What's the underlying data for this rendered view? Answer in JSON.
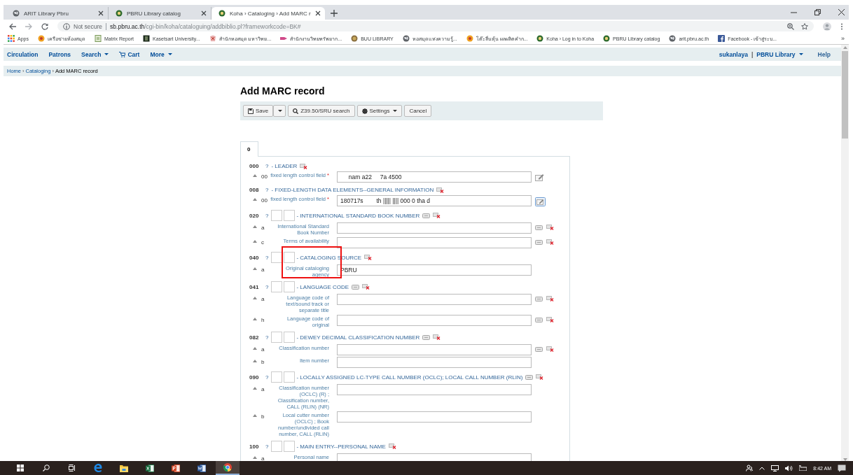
{
  "browser": {
    "tabs": [
      {
        "title": "ARIT Library Pbru",
        "selected": false
      },
      {
        "title": "PBRU Library catalog",
        "selected": false
      },
      {
        "title": "Koha › Cataloging › Add MARC r",
        "selected": true
      }
    ],
    "address": {
      "security": "Not secure",
      "host": "sb.pbru.ac.th",
      "path": "/cgi-bin/koha/cataloguing/addbiblio.pl?frameworkcode=BK#"
    },
    "bookmarks": [
      {
        "title": "Apps"
      },
      {
        "title": "เครือข่ายห้องสมุด"
      },
      {
        "title": "Matrix Report"
      },
      {
        "title": "Kasetsart University..."
      },
      {
        "title": "สำนักหอสมุด มหาวิทย..."
      },
      {
        "title": "สำนักงานวิทยทรัพยาก..."
      },
      {
        "title": "BUU LIBRARY"
      },
      {
        "title": "หอสมุดแห่งความรู้..."
      },
      {
        "title": "โต๊ะลื่นหุ้น ผลผลิตคำก..."
      },
      {
        "title": "Koha › Log in to Koha"
      },
      {
        "title": "PBRU Library catalog"
      },
      {
        "title": "arit.pbru.ac.th"
      },
      {
        "title": "Facebook - เข้าสู่ระบ..."
      }
    ],
    "more": "»"
  },
  "nav": {
    "left": [
      {
        "label": "Circulation",
        "kind": "link"
      },
      {
        "label": "Patrons",
        "kind": "link"
      },
      {
        "label": "Search",
        "kind": "menu"
      },
      {
        "label": "Cart",
        "kind": "cart"
      },
      {
        "label": "More",
        "kind": "menu"
      }
    ],
    "user": "sukanlaya",
    "separator": "|",
    "library": "PBRU Library",
    "help": "Help"
  },
  "breadcrumb": [
    {
      "label": "Home",
      "link": true
    },
    {
      "separator": "›",
      "label": "Cataloging",
      "link": true
    },
    {
      "separator": "›",
      "label": "Add MARC record",
      "link": false
    }
  ],
  "heading": "Add MARC record",
  "toolbar": [
    {
      "kind": "save",
      "label": "Save"
    },
    {
      "kind": "split"
    },
    {
      "kind": "search",
      "label": "Z39.50/SRU search"
    },
    {
      "kind": "settings",
      "label": "Settings"
    },
    {
      "kind": "plain",
      "label": "Cancel"
    }
  ],
  "tabs": [
    {
      "label": "0",
      "selected": true
    }
  ],
  "fields": [
    {
      "tag": "000",
      "help": "?",
      "indicators": false,
      "title": "- LEADER",
      "repeatable": false,
      "removable": true,
      "subfields": [
        {
          "code": "00",
          "label": "fixed length control field",
          "marker": "*",
          "value": "     nam a22     7a 4500",
          "repeatable": false,
          "removable": false,
          "plugin": true,
          "focused": false
        }
      ]
    },
    {
      "tag": "008",
      "help": "?",
      "indicators": false,
      "title": "- FIXED-LENGTH DATA ELEMENTS--GENERAL INFORMATION",
      "repeatable": false,
      "removable": true,
      "subfields": [
        {
          "code": "00",
          "label": "fixed length control field",
          "marker": "*",
          "value": "180717s        th ||||| |||| 000 0 tha d",
          "repeatable": false,
          "removable": false,
          "plugin": true,
          "focused": true
        }
      ]
    },
    {
      "tag": "020",
      "help": "?",
      "indicators": true,
      "title": "- INTERNATIONAL STANDARD BOOK NUMBER",
      "repeatable": true,
      "removable": true,
      "subfields": [
        {
          "code": "a",
          "label": "International Standard Book Number",
          "repeatable": true,
          "removable": true,
          "plugin": false
        },
        {
          "code": "c",
          "label": "Terms of availability",
          "repeatable": true,
          "removable": true,
          "plugin": false
        }
      ]
    },
    {
      "tag": "040",
      "help": "?",
      "indicators": true,
      "title": "- CATALOGING SOURCE",
      "repeatable": false,
      "removable": true,
      "subfields": [
        {
          "code": "a",
          "label": "Original cataloging agency",
          "value": "PBRU",
          "repeatable": false,
          "removable": false,
          "plugin": false
        }
      ]
    },
    {
      "tag": "041",
      "help": "?",
      "indicators": true,
      "title": "- LANGUAGE CODE",
      "repeatable": true,
      "removable": true,
      "subfields": [
        {
          "code": "a",
          "label": "Language code of text/sound track or separate title",
          "repeatable": true,
          "removable": true,
          "plugin": false
        },
        {
          "code": "h",
          "label": "Language code of original",
          "repeatable": true,
          "removable": true,
          "plugin": false
        }
      ]
    },
    {
      "tag": "082",
      "help": "?",
      "indicators": true,
      "title": "- DEWEY DECIMAL CLASSIFICATION NUMBER",
      "repeatable": true,
      "removable": true,
      "subfields": [
        {
          "code": "a",
          "label": "Classification number",
          "repeatable": true,
          "removable": true,
          "plugin": false
        },
        {
          "code": "b",
          "label": "Item number",
          "repeatable": false,
          "removable": false,
          "plugin": false
        }
      ]
    },
    {
      "tag": "090",
      "help": "?",
      "indicators": true,
      "title": "- LOCALLY ASSIGNED LC-TYPE CALL NUMBER (OCLC); LOCAL CALL NUMBER (RLIN)",
      "repeatable": true,
      "removable": true,
      "subfields": [
        {
          "code": "a",
          "label": "Classification number (OCLC) (R) ; Classification number, CALL (RLIN) (NR)",
          "repeatable": false,
          "removable": false,
          "plugin": false
        },
        {
          "code": "b",
          "label": "Local cutter number (OCLC) ; Book number/undivided call number, CALL (RLIN)",
          "repeatable": false,
          "removable": false,
          "plugin": false
        }
      ]
    },
    {
      "tag": "100",
      "help": "?",
      "indicators": true,
      "title": "- MAIN ENTRY--PERSONAL NAME",
      "repeatable": false,
      "removable": true,
      "subfields": [
        {
          "code": "a",
          "label": "Personal name",
          "repeatable": false,
          "removable": false,
          "plugin": false
        }
      ]
    }
  ],
  "taskbar": {
    "apps": [
      {
        "kind": "start",
        "selected": false
      },
      {
        "kind": "search",
        "selected": false
      },
      {
        "kind": "taskview",
        "selected": false
      },
      {
        "kind": "edge",
        "selected": false
      },
      {
        "kind": "explorer",
        "selected": false
      },
      {
        "kind": "excel",
        "selected": false
      },
      {
        "kind": "powerpoint",
        "selected": false
      },
      {
        "kind": "word",
        "selected": false
      },
      {
        "kind": "chrome",
        "selected": true
      }
    ],
    "time": "8:42 AM"
  }
}
